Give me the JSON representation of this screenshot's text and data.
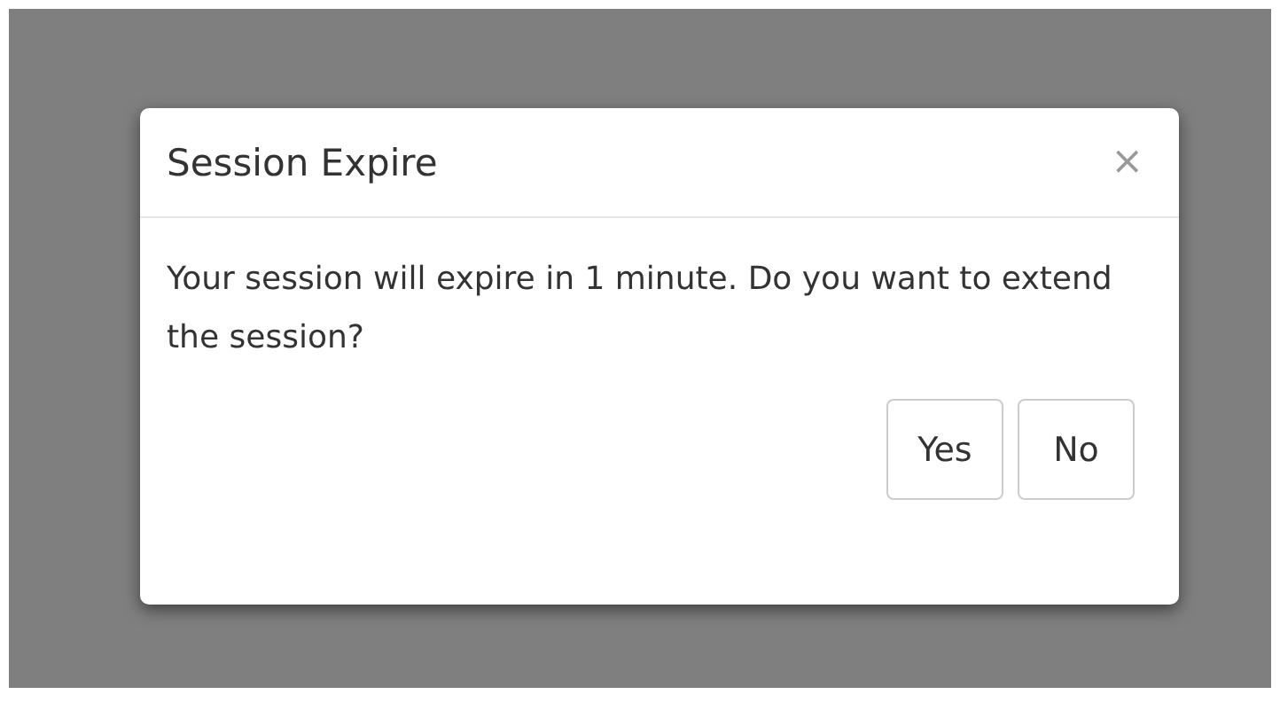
{
  "dialog": {
    "title": "Session Expire",
    "close": "×",
    "message": "Your session will expire in 1 minute. Do you want to extend the session?",
    "buttons": [
      "Yes",
      "No"
    ]
  }
}
